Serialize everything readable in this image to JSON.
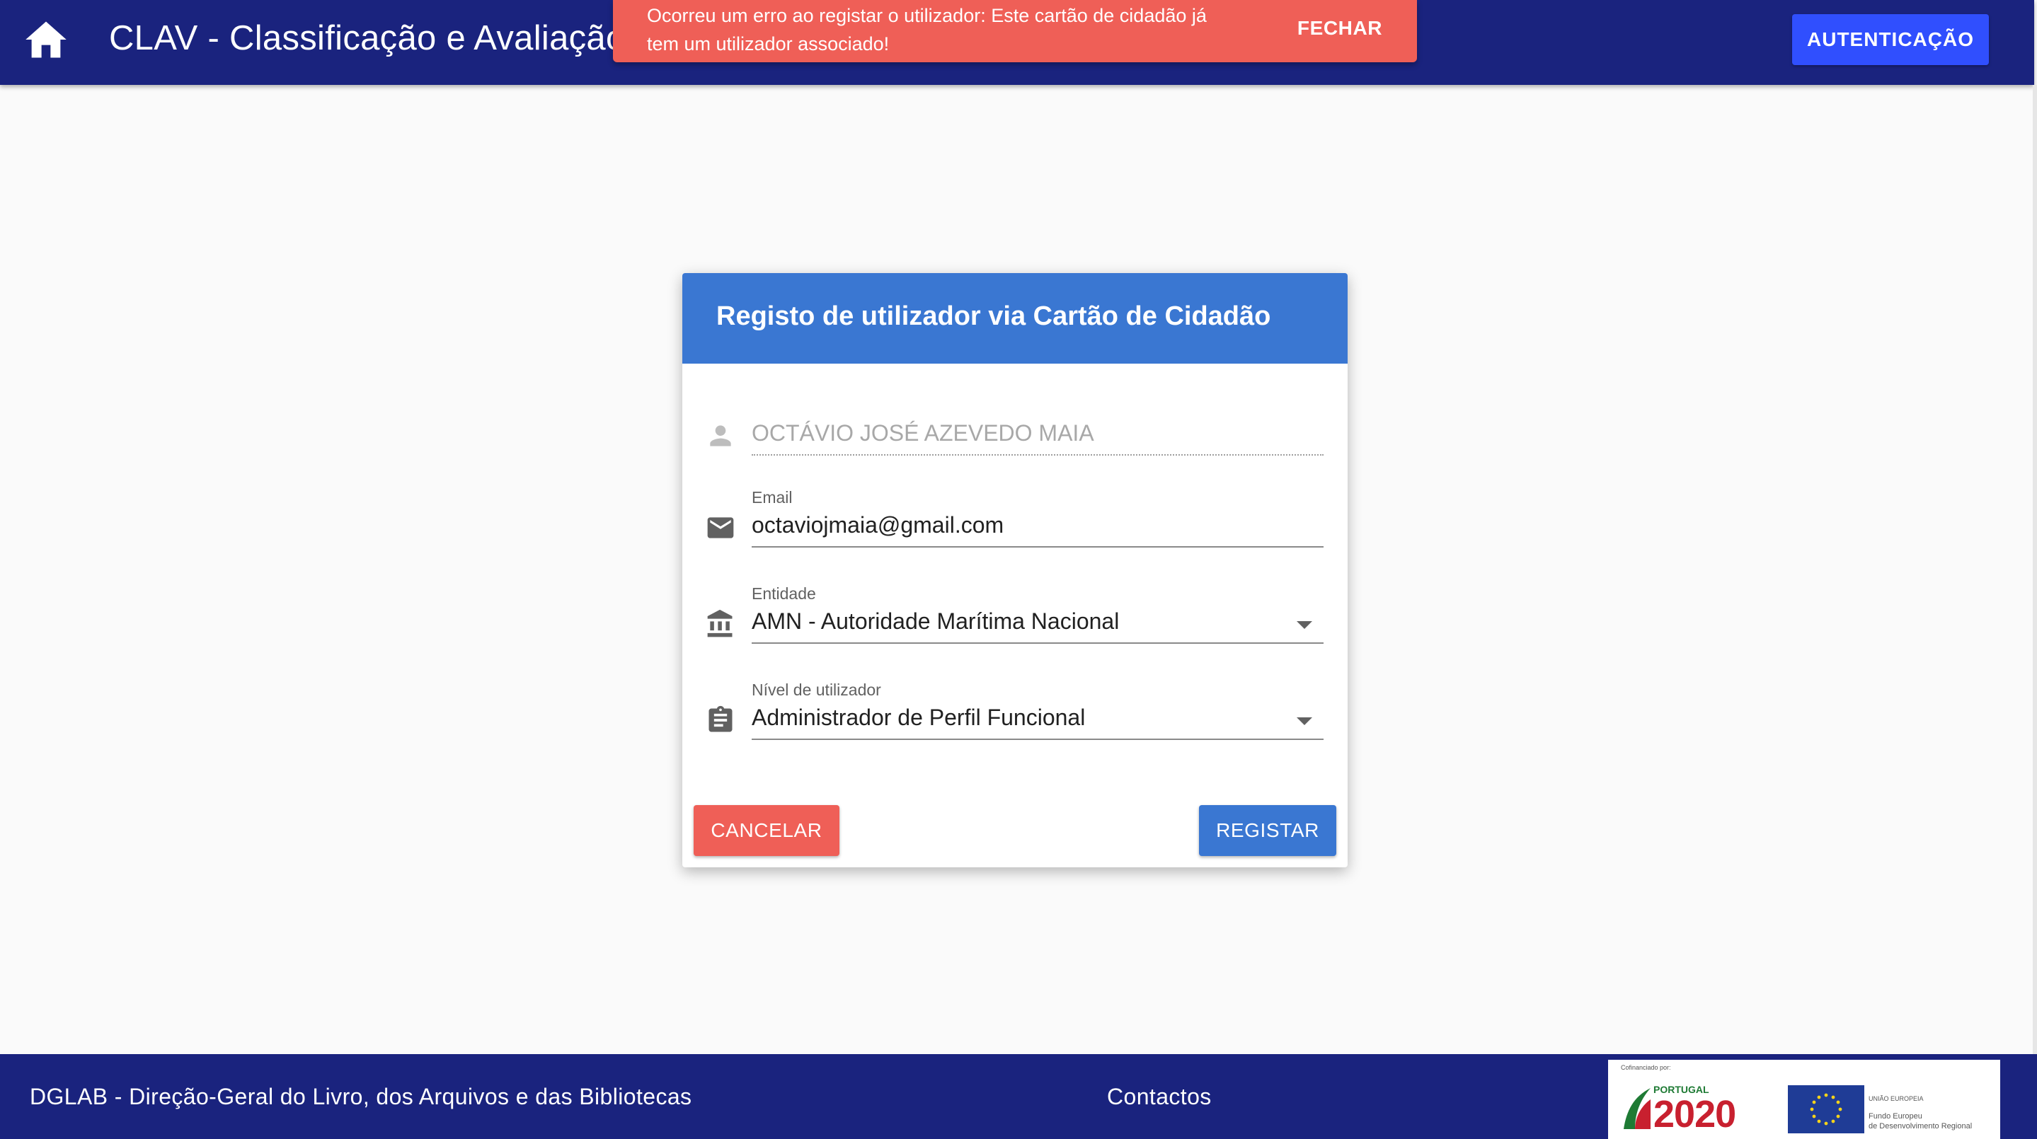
{
  "header": {
    "brand": "CLAV",
    "title_rest": " - Classificação e Avaliação d",
    "auth_button": "AUTENTICAÇÃO"
  },
  "snackbar": {
    "message": "Ocorreu um erro ao registar o utilizador: Este cartão de cidadão já tem um utilizador associado!",
    "close_label": "FECHAR"
  },
  "card": {
    "title": "Registo de utilizador via Cartão de Cidadão",
    "fields": {
      "name": {
        "value": "OCTÁVIO JOSÉ AZEVEDO MAIA",
        "icon": "person-icon"
      },
      "email": {
        "label": "Email",
        "value": "octaviojmaia@gmail.com",
        "icon": "email-icon"
      },
      "entity": {
        "label": "Entidade",
        "value": "AMN - Autoridade Marítima Nacional",
        "icon": "institution-icon"
      },
      "level": {
        "label": "Nível de utilizador",
        "value": "Administrador de Perfil Funcional",
        "icon": "clipboard-icon"
      }
    },
    "cancel_label": "CANCELAR",
    "register_label": "REGISTAR"
  },
  "footer": {
    "org": "DGLAB - Direção-Geral do Livro, dos Arquivos e das Bibliotecas",
    "contacts": "Contactos",
    "logo": {
      "cofinanced": "Cofinanciado por:",
      "portugal": "PORTUGAL",
      "year": "2020",
      "eu": "UNIÃO EUROPEIA",
      "fund_line1": "Fundo Europeu",
      "fund_line2": "de Desenvolvimento Regional"
    }
  },
  "colors": {
    "primary": "#1a237e",
    "accent": "#304ffe",
    "card_header": "#3a77d2",
    "error": "#ef5f57"
  }
}
